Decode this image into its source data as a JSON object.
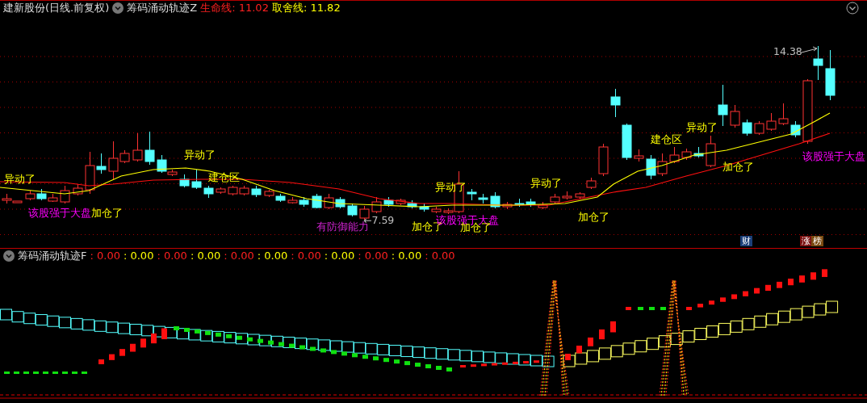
{
  "header": {
    "title": "建新股份(日线.前复权)",
    "indicator": "筹码涌动轨迹Z",
    "legend": [
      {
        "text": "生命线: 11.02",
        "color": "#ff2020"
      },
      {
        "text": "取舍线: 11.82",
        "color": "#ffff00"
      }
    ]
  },
  "main_chart": {
    "annotations": [
      {
        "text": "异动了",
        "color": "#ffff00"
      },
      {
        "text": "该股强于大盘",
        "color": "#ff00ff"
      },
      {
        "text": "加仓了",
        "color": "#ffff00"
      },
      {
        "text": "异动了",
        "color": "#ffff00"
      },
      {
        "text": "建仓区",
        "color": "#ffff00"
      },
      {
        "text": "有防御能力",
        "color": "#cc22cc"
      },
      {
        "text": "←7.59",
        "color": "#c0c0c0"
      },
      {
        "text": "加仓了",
        "color": "#ffff00"
      },
      {
        "text": "异动了",
        "color": "#ffff00"
      },
      {
        "text": "该股强于大盘",
        "color": "#ff00ff"
      },
      {
        "text": "加仓了",
        "color": "#ffff00"
      },
      {
        "text": "异动了",
        "color": "#ffff00"
      },
      {
        "text": "加仓了",
        "color": "#ffff00"
      },
      {
        "text": "建仓区",
        "color": "#ffff00"
      },
      {
        "text": "异动了",
        "color": "#ffff00"
      },
      {
        "text": "加仓了",
        "color": "#ffff00"
      },
      {
        "text": "该股强于大盘",
        "color": "#ff00ff"
      },
      {
        "text": "14.38",
        "color": "#c0c0c0"
      }
    ],
    "badges": [
      {
        "text": "财",
        "color": "#1c3f78"
      },
      {
        "text": "涨",
        "color": "#7a1010"
      },
      {
        "text": "榜",
        "color": "#7a4a10"
      }
    ]
  },
  "sub_chart": {
    "title": "筹码涌动轨迹F",
    "values": [
      {
        "text": ": 0.00",
        "color": "#ff2020"
      },
      {
        "text": ": 0.00",
        "color": "#ffff00"
      },
      {
        "text": ": 0.00",
        "color": "#ff2020"
      },
      {
        "text": ": 0.00",
        "color": "#ffff00"
      },
      {
        "text": ": 0.00",
        "color": "#ff2020"
      },
      {
        "text": ": 0.00",
        "color": "#ffff00"
      },
      {
        "text": ": 0.00",
        "color": "#ff2020"
      },
      {
        "text": ": 0.00",
        "color": "#ffff00"
      },
      {
        "text": ": 0.00",
        "color": "#ff2020"
      },
      {
        "text": ": 0.00",
        "color": "#ffff00"
      },
      {
        "text": ": 0.00",
        "color": "#ff2020"
      }
    ]
  }
}
